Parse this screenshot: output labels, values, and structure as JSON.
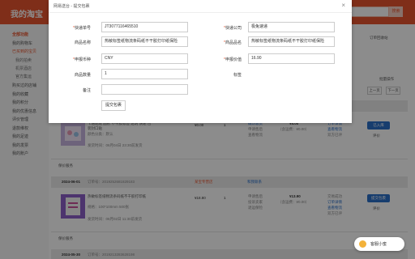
{
  "brand": "我的淘宝",
  "search": {
    "button": "搜索"
  },
  "sidebar": {
    "items": [
      {
        "label": "全部功能",
        "kind": "head"
      },
      {
        "label": "我的购物车",
        "kind": "normal"
      },
      {
        "label": "已买到的宝贝",
        "kind": "active"
      },
      {
        "label": "我的拍卖",
        "kind": "sub"
      },
      {
        "label": "机票酒店",
        "kind": "sub"
      },
      {
        "label": "官方集运",
        "kind": "sub"
      },
      {
        "label": "购买过的店铺",
        "kind": "normal"
      },
      {
        "label": "我的收藏",
        "kind": "normal"
      },
      {
        "label": "我的积分",
        "kind": "normal"
      },
      {
        "label": "我的优惠信息",
        "kind": "normal"
      },
      {
        "label": "评价管理",
        "kind": "normal"
      },
      {
        "label": "退款维权",
        "kind": "normal"
      },
      {
        "label": "我的足迹",
        "kind": "normal"
      },
      {
        "label": "我的发票",
        "kind": "normal"
      },
      {
        "label": "我的账户",
        "kind": "normal"
      }
    ]
  },
  "content": {
    "recycle": "订单回收站",
    "more_ops": "批量操作",
    "prev": "上一页",
    "next": "下一页",
    "orders": [
      {
        "title": "卡通贴纸 圆形 不干胶标签 透明 快递 包装封口贴",
        "meta": "颜色分类：默认",
        "time": "发货时间：06月04日 23:30前发货",
        "price": "¥0.00",
        "qty": "1",
        "actions": [
          "确认收货",
          "申请售后",
          "查看物流"
        ],
        "total": "¥5.00",
        "total_note": "（含运费：¥0.00）",
        "status": [
          "订单详情",
          "查看物流",
          "双方已评"
        ],
        "primary": "已入库",
        "secondary": "评价"
      },
      {
        "date": "2024-06-01",
        "order_no": "订单号：2019252681829183",
        "shop": "某宝专营店",
        "chat": "和我联系",
        "title": "热敏标签纸物流条码纸不干胶打印纸",
        "meta": "规格：100*100mm 500张",
        "time": "发货时间：06月02日 11:30前发货",
        "price": "¥18.80",
        "qty": "1",
        "actions": [
          "申请售后",
          "投诉卖家",
          "退运保险"
        ],
        "total": "¥13.90",
        "total_note": "（含运费：¥0.00）",
        "status": [
          "交易成功",
          "订单详情",
          "查看物流",
          "双方已评"
        ],
        "primary": "提交包裹",
        "secondary": "评价"
      },
      {
        "date": "2024-05-30",
        "order_no": "订单号：2019213283628198"
      }
    ],
    "lowest_price": "保价服务"
  },
  "modal": {
    "title": "网易送台 - 提交包裹",
    "close": "×",
    "fields": {
      "tracking_no": {
        "label": "快递单号",
        "required": true,
        "value": "JT3077116465510"
      },
      "courier": {
        "label": "快递公司",
        "required": true,
        "value": "极兔速递"
      },
      "goods_name": {
        "label": "商品名称",
        "required": false,
        "value": "热敏标签纸物流条码纸不干胶打印纸保险"
      },
      "goods_name_en": {
        "label": "商品品名",
        "required": true,
        "value": "热敏标签纸物流条码纸不干胶打印纸保险"
      },
      "currency": {
        "label": "申报币种",
        "required": true,
        "value": "CNY"
      },
      "declared_value": {
        "label": "申报价值",
        "required": true,
        "value": "16.90"
      },
      "quantity": {
        "label": "商品数量",
        "required": false,
        "value": "1"
      },
      "tag": {
        "label": "标签",
        "required": false,
        "value": ""
      },
      "remark": {
        "label": "备注",
        "required": false,
        "value": ""
      }
    },
    "submit": "提交包裹"
  },
  "float_button": "客服小蜜"
}
